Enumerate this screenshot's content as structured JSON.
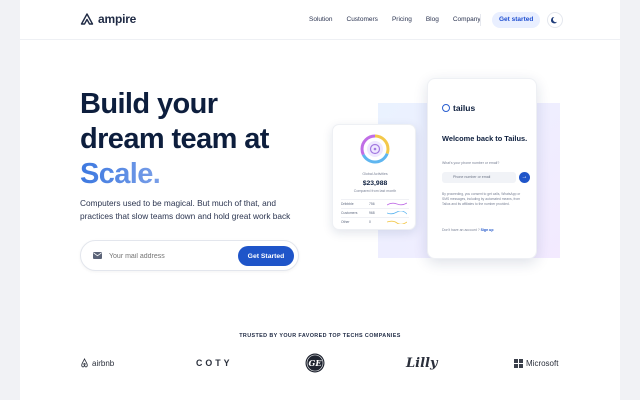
{
  "nav": {
    "logo": "ampire",
    "links": [
      "Solution",
      "Customers",
      "Pricing",
      "Blog",
      "Company"
    ],
    "cta": "Get started"
  },
  "hero": {
    "title_line1": "Build your",
    "title_line2": "dream team at",
    "title_line3": "Scale.",
    "lead": "Computers used to be magical. But much of that, and practices that slow teams down and hold great work back",
    "email_placeholder": "Your mail address",
    "submit": "Get Started"
  },
  "card_stats": {
    "label": "Global Activities",
    "amount": "$23,988",
    "sublabel": "Compared from last month",
    "rows": [
      {
        "name": "Dribbble",
        "value": "756"
      },
      {
        "name": "Customers",
        "value": "968"
      },
      {
        "name": "Other",
        "value": "0"
      }
    ]
  },
  "card_login": {
    "brand": "tailus",
    "welcome": "Welcome back to Tailus.",
    "phone_label": "What's your phone number or email?",
    "phone_placeholder": "Phone number or email",
    "fine_print": "By proceeding, you consent to get calls, WhatsApp or SMS messages, including by automated means, from Tailus and its affiliates to the number provided.",
    "signup_text": "Don't have an account ?",
    "signup_link": "Sign up"
  },
  "trusted": {
    "heading": "TRUSTED BY YOUR FAVORED TOP TECHS COMPANIES",
    "logos": [
      "airbnb",
      "COTY",
      "GE",
      "Lilly",
      "Microsoft"
    ]
  },
  "colors": {
    "accent": "#1f55c9",
    "title": "#0d1e3d"
  }
}
